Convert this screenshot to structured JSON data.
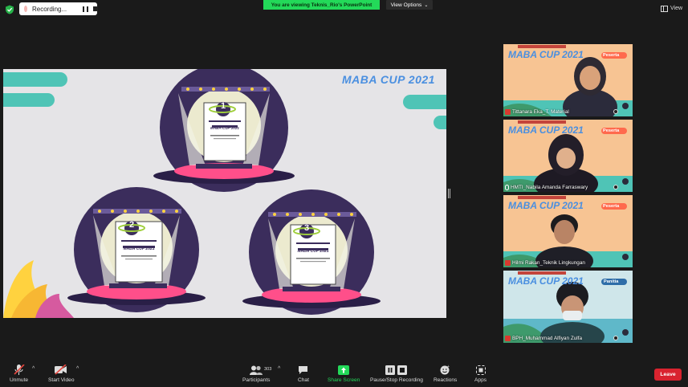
{
  "top": {
    "recording_label": "Recording...",
    "viewing_banner": "You are viewing Teknis_Rio's PowerPoint",
    "view_options_label": "View Options",
    "view_label": "View"
  },
  "slide": {
    "logo_text": "MABA CUP 2021",
    "trophy_title": "MABA CUP 2021",
    "trophy_subtitle": "MENULIS CERPEN",
    "places": [
      "1",
      "2",
      "3"
    ],
    "place_small": [
      "st",
      "nd",
      "rd"
    ],
    "winners": [
      "Hilman Rakan Pumarsya Jodi",
      "Hilman Rakan Pumarsya Jodi",
      "Nabila Amanda Farraswary"
    ],
    "colors": {
      "stage": "#3b2d5c",
      "accent": "#4fc4b6",
      "pink": "#ff4f8a",
      "yellow": "#ffd23f"
    }
  },
  "participants": [
    {
      "name": "Tittanara Eka_T. Material",
      "role": "Peserta",
      "muted": true
    },
    {
      "name": "HMTI_Nabila Amanda Farraswary",
      "role": "Peserta",
      "muted": false
    },
    {
      "name": "Hilmi Rakan_Teknik Lingkungan",
      "role": "Peserta",
      "muted": true
    },
    {
      "name": "BPH_Muhammad Alfiyan Zulfa",
      "role": "Panitia",
      "muted": true
    }
  ],
  "tile_banner": "MABA CUP 2021",
  "toolbar": {
    "unmute": "Unmute",
    "start_video": "Start Video",
    "participants": "Participants",
    "participants_count": "303",
    "chat": "Chat",
    "share_screen": "Share Screen",
    "pause_stop_recording": "Pause/Stop Recording",
    "reactions": "Reactions",
    "apps": "Apps",
    "leave": "Leave"
  }
}
